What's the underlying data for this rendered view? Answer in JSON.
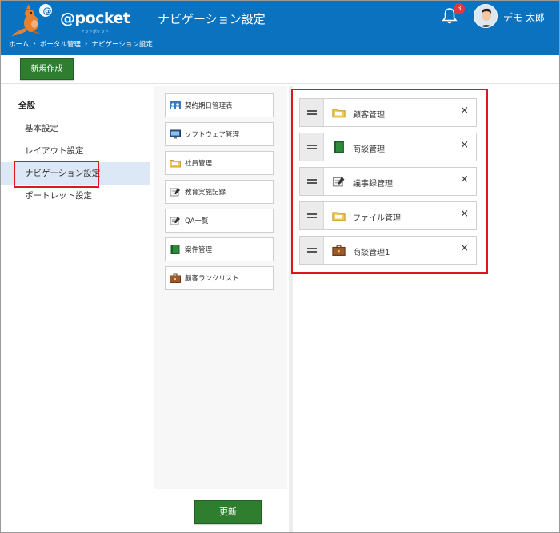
{
  "app": {
    "logo_text": "@pocket",
    "logo_sub": "アットポケット",
    "page_title": "ナビゲーション設定",
    "notification_count": "3",
    "user_name": "デモ 太郎"
  },
  "breadcrumb": {
    "items": [
      "ホーム",
      "ポータル管理",
      "ナビゲーション設定"
    ],
    "separator": "›"
  },
  "toolbar": {
    "new_label": "新規作成"
  },
  "sidebar": {
    "heading": "全般",
    "items": [
      {
        "label": "基本設定"
      },
      {
        "label": "レイアウト設定"
      },
      {
        "label": "ナビゲーション設定",
        "active": true
      },
      {
        "label": "ポートレット設定"
      }
    ]
  },
  "palette": {
    "items": [
      {
        "label": "契約期日管理表",
        "icon": "people-group-icon"
      },
      {
        "label": "ソフトウェア管理",
        "icon": "monitor-icon"
      },
      {
        "label": "社員管理",
        "icon": "folder-icon"
      },
      {
        "label": "教育実施記録",
        "icon": "notepad-icon"
      },
      {
        "label": "QA一覧",
        "icon": "notepad-icon"
      },
      {
        "label": "案件管理",
        "icon": "green-book-icon"
      },
      {
        "label": "顧客ランクリスト",
        "icon": "briefcase-icon"
      }
    ]
  },
  "selected": {
    "items": [
      {
        "label": "顧客管理",
        "icon": "folder-icon"
      },
      {
        "label": "商談管理",
        "icon": "green-book-icon"
      },
      {
        "label": "議事録管理",
        "icon": "notepad-icon"
      },
      {
        "label": "ファイル管理",
        "icon": "folder-icon"
      },
      {
        "label": "商談管理1",
        "icon": "briefcase-icon"
      }
    ],
    "close_glyph": "×"
  },
  "footer": {
    "update_label": "更新"
  },
  "colors": {
    "header_bg": "#0a72bf",
    "primary_button": "#2f7d2e",
    "highlight_border": "#e0161c",
    "active_nav_bg": "#dde8f6",
    "badge": "#e03a3a"
  }
}
